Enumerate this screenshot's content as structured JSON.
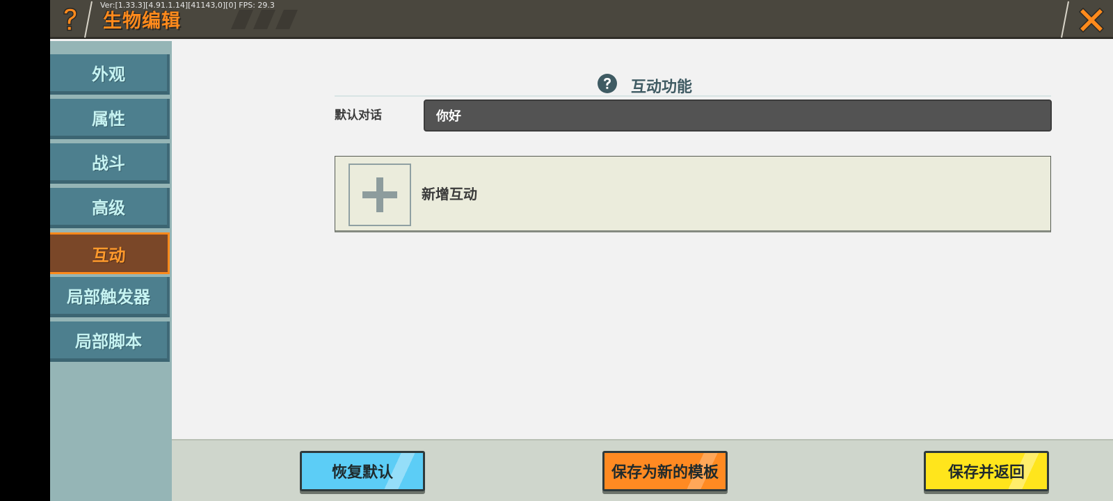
{
  "header": {
    "title": "生物编辑",
    "version": "Ver:[1.33.3][4.91.1.14][41143,0][0] FPS: 29.3"
  },
  "sidebar": {
    "items": [
      {
        "label": "外观",
        "active": false
      },
      {
        "label": "属性",
        "active": false
      },
      {
        "label": "战斗",
        "active": false
      },
      {
        "label": "高级",
        "active": false
      },
      {
        "label": "互动",
        "active": true
      },
      {
        "label": "局部触发器",
        "active": false
      },
      {
        "label": "局部脚本",
        "active": false
      }
    ]
  },
  "content": {
    "section_title": "互动功能",
    "dialog_label": "默认对话",
    "dialog_value": "你好",
    "add_label": "新增互动"
  },
  "footer": {
    "reset_label": "恢复默认",
    "template_label": "保存为新的模板",
    "save_label": "保存并返回"
  },
  "colors": {
    "accent": "#ff8a1c",
    "sidebar_item": "#4d7f8e",
    "sidebar_active": "#7a4728",
    "reset_button": "#5ccdf6",
    "template_button": "#ff8a22",
    "save_button": "#ffe51c"
  },
  "icons": {
    "help": "question-icon",
    "close": "close-icon",
    "add": "plus-icon",
    "section_help": "question-circle-icon"
  }
}
